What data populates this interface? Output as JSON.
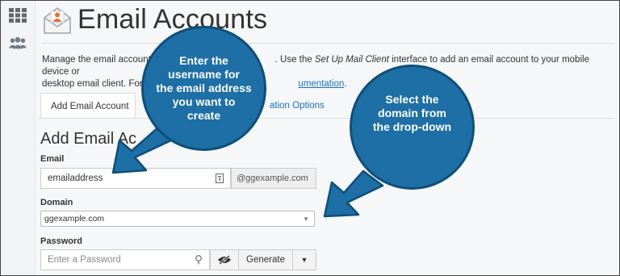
{
  "page": {
    "title": "Email Accounts",
    "description_line1_a": "Manage the email accounts",
    "description_line1_b": ". Use the",
    "description_line1_em": "Set Up Mail Client",
    "description_line1_c": "interface to add an email account to your mobile device or",
    "description_line2_a": "desktop email client. For m",
    "description_line2_link": "umentation",
    "description_line2_end": "."
  },
  "tabs": [
    {
      "label": "Add Email Account"
    },
    {
      "label": "E"
    },
    {
      "label": "ation Options"
    }
  ],
  "form": {
    "section_title": "Add Email Ac",
    "section_title_tail": "nt",
    "email_label": "Email",
    "email_value": "emailaddress",
    "email_domain_addon": "@ggexample.com",
    "domain_label": "Domain",
    "domain_selected": "ggexample.com",
    "password_label": "Password",
    "password_placeholder": "Enter a Password",
    "generate_label": "Generate"
  },
  "callouts": {
    "left": [
      "Enter the",
      "username for",
      "the email address",
      "you want to",
      "create"
    ],
    "right": [
      "Select the",
      "domain from",
      "the drop-down"
    ]
  },
  "icons": {
    "apps": "grid-icon",
    "users": "users-icon",
    "envelope": "envelope-user-icon",
    "key": "key-icon",
    "eye": "eye-slash-icon",
    "caret": "caret-down-icon"
  },
  "colors": {
    "callout_fill": "#1d6fa5",
    "callout_border": "#0f4f7a",
    "link": "#1a73b8",
    "icon_orange": "#e8702a"
  }
}
